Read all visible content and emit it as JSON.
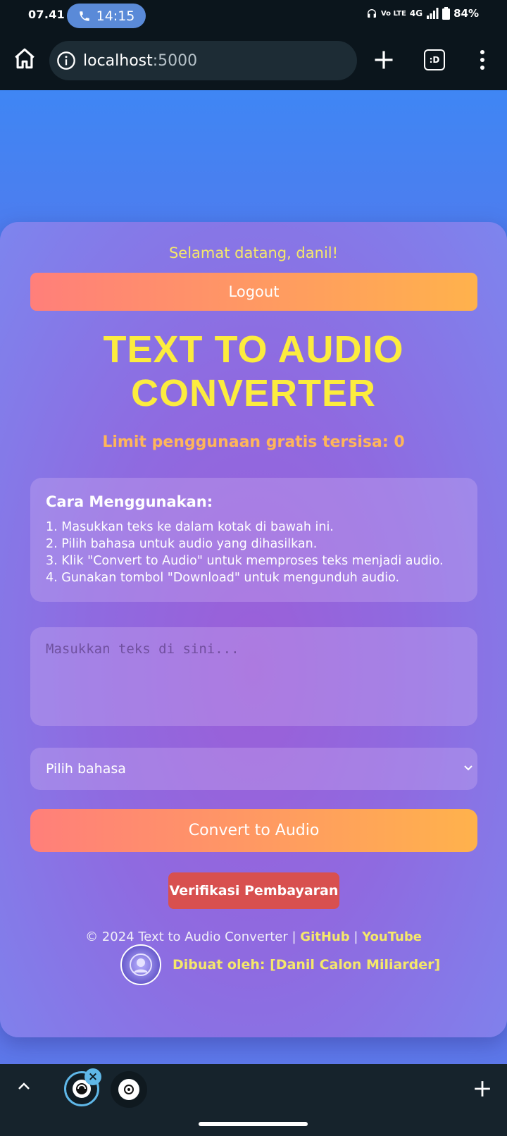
{
  "status_bar": {
    "time": "07.41",
    "call_duration": "14:15",
    "network": "4G",
    "volte": "Vo LTE",
    "battery": "84%"
  },
  "browser": {
    "url_host": "localhost",
    "url_port": ":5000",
    "tab_switcher_label": ":D"
  },
  "page": {
    "welcome": "Selamat datang, danil!",
    "logout_label": "Logout",
    "title": "TEXT TO AUDIO CONVERTER",
    "limit_text": "Limit penggunaan gratis tersisa: 0",
    "guide": {
      "title": "Cara Menggunakan:",
      "steps": [
        "1. Masukkan teks ke dalam kotak di bawah ini.",
        "2. Pilih bahasa untuk audio yang dihasilkan.",
        "3. Klik \"Convert to Audio\" untuk memproses teks menjadi audio.",
        "4. Gunakan tombol \"Download\" untuk mengunduh audio."
      ]
    },
    "text_input": {
      "placeholder": "Masukkan teks di sini...",
      "value": ""
    },
    "language_select": {
      "selected": "Pilih bahasa"
    },
    "convert_label": "Convert to Audio",
    "verify_label": "Verifikasi Pembayaran",
    "footer": {
      "copyright": "© 2024 Text to Audio Converter |",
      "github": "GitHub",
      "separator": "|",
      "youtube": "YouTube",
      "credit": "Dibuat oleh: [Danil Calon Miliarder]"
    }
  },
  "colors": {
    "accent_yellow": "#fcec3e",
    "orange_gradient_start": "#ff7f7a",
    "orange_gradient_end": "#ffb24c",
    "verify_red": "#d8504f",
    "active_tab_ring": "#5fb7e8"
  }
}
